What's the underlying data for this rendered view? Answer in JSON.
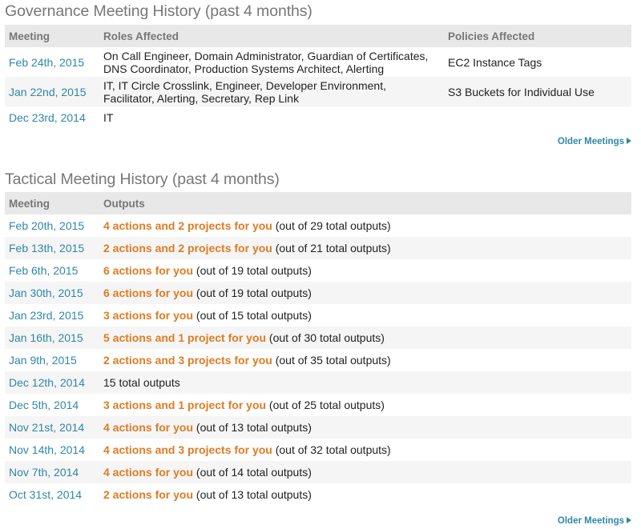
{
  "governance": {
    "title": "Governance Meeting History (past 4 months)",
    "columns": {
      "meeting": "Meeting",
      "roles": "Roles Affected",
      "policies": "Policies Affected"
    },
    "rows": [
      {
        "date": "Feb 24th, 2015",
        "roles": "On Call Engineer, Domain Administrator, Guardian of Certificates, DNS Coordinator, Production Systems Architect, Alerting",
        "policies": "EC2 Instance Tags"
      },
      {
        "date": "Jan 22nd, 2015",
        "roles": "IT, IT Circle Crosslink, Engineer, Developer Environment, Facilitator, Alerting, Secretary, Rep Link",
        "policies": "S3 Buckets for Individual Use"
      },
      {
        "date": "Dec 23rd, 2014",
        "roles": "IT",
        "policies": ""
      }
    ],
    "older_label": "Older Meetings"
  },
  "tactical": {
    "title": "Tactical Meeting History (past 4 months)",
    "columns": {
      "meeting": "Meeting",
      "outputs": "Outputs"
    },
    "rows": [
      {
        "date": "Feb 20th, 2015",
        "highlight": "4 actions and 2 projects for you",
        "rest": " (out of 29 total outputs)"
      },
      {
        "date": "Feb 13th, 2015",
        "highlight": "2 actions and 2 projects for you",
        "rest": " (out of 21 total outputs)"
      },
      {
        "date": "Feb 6th, 2015",
        "highlight": "6 actions for you",
        "rest": " (out of 19 total outputs)"
      },
      {
        "date": "Jan 30th, 2015",
        "highlight": "6 actions for you",
        "rest": " (out of 19 total outputs)"
      },
      {
        "date": "Jan 23rd, 2015",
        "highlight": "3 actions for you",
        "rest": " (out of 15 total outputs)"
      },
      {
        "date": "Jan 16th, 2015",
        "highlight": "5 actions and 1 project for you",
        "rest": " (out of 30 total outputs)"
      },
      {
        "date": "Jan 9th, 2015",
        "highlight": "2 actions and 3 projects for you",
        "rest": " (out of 35 total outputs)"
      },
      {
        "date": "Dec 12th, 2014",
        "highlight": "",
        "rest": "15 total outputs"
      },
      {
        "date": "Dec 5th, 2014",
        "highlight": "3 actions and 1 project for you",
        "rest": " (out of 25 total outputs)"
      },
      {
        "date": "Nov 21st, 2014",
        "highlight": "4 actions for you",
        "rest": " (out of 13 total outputs)"
      },
      {
        "date": "Nov 14th, 2014",
        "highlight": "4 actions and 3 projects for you",
        "rest": " (out of 32 total outputs)"
      },
      {
        "date": "Nov 7th, 2014",
        "highlight": "4 actions for you",
        "rest": " (out of 14 total outputs)"
      },
      {
        "date": "Oct 31st, 2014",
        "highlight": "2 actions for you",
        "rest": " (out of 13 total outputs)"
      }
    ],
    "older_label": "Older Meetings"
  },
  "colors": {
    "link": "#2f87a8",
    "highlight": "#e07b22",
    "header_bg": "#e8e8e8",
    "header_text": "#777777",
    "stripe": "#f5f5f5"
  },
  "icons": {
    "older_arrow": "triangle-right-icon"
  }
}
